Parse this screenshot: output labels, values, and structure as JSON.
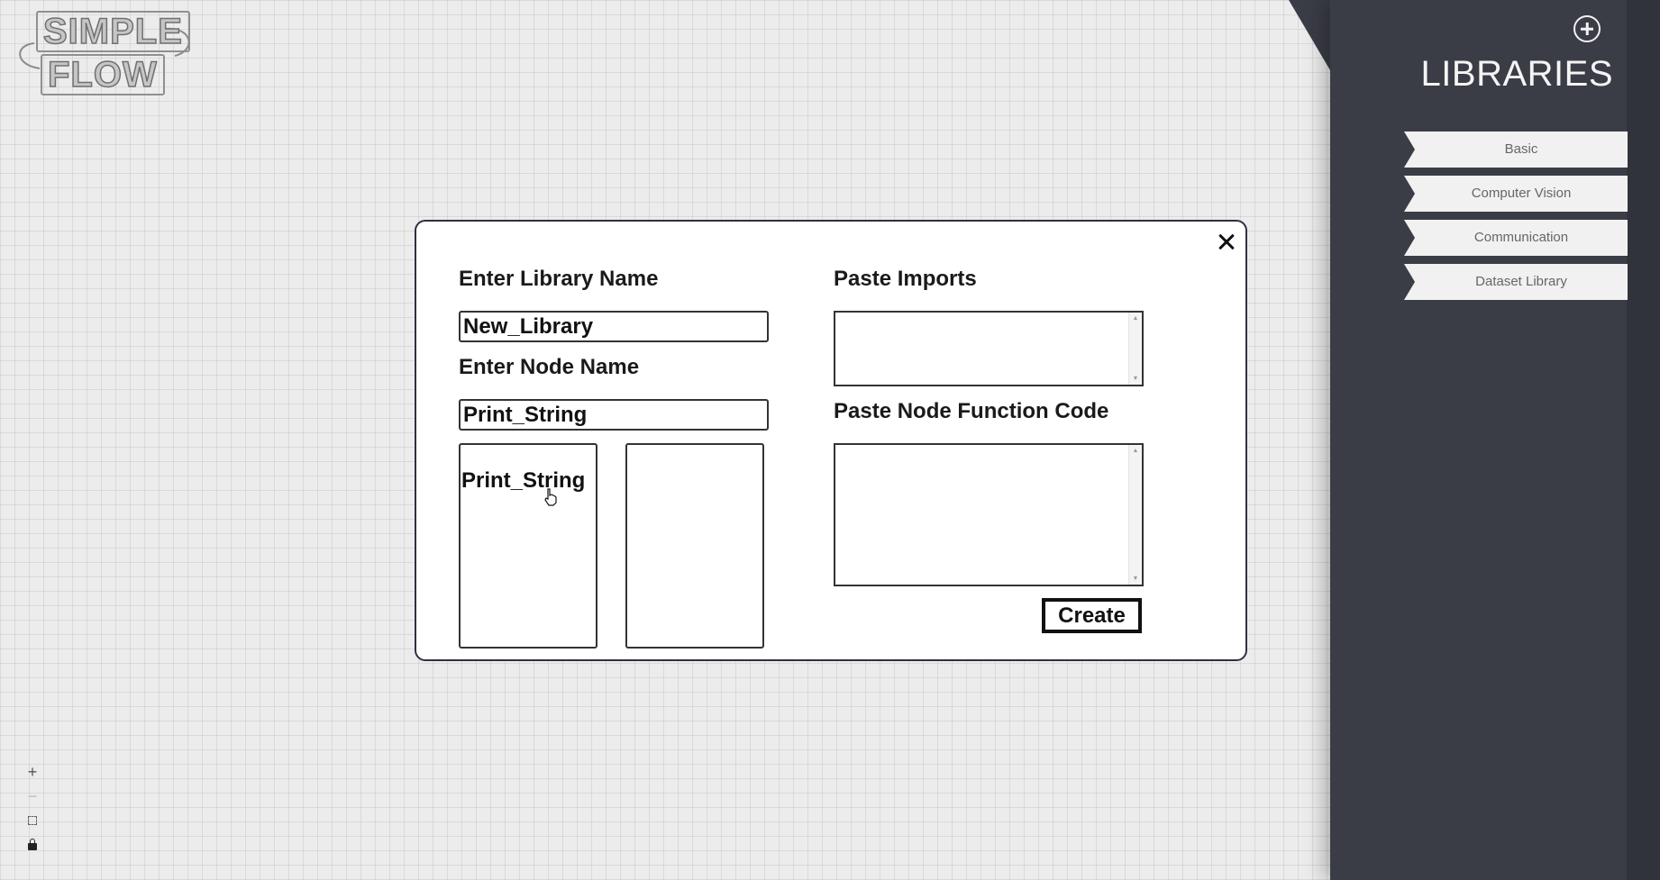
{
  "logo": {
    "line1": "SIMPLE",
    "line2": "FLOW"
  },
  "sidebar": {
    "title": "LIBRARIES",
    "add_icon": "plus-circle-icon",
    "libraries": [
      {
        "label": "Basic"
      },
      {
        "label": "Computer Vision"
      },
      {
        "label": "Communication"
      },
      {
        "label": "Dataset Library"
      }
    ]
  },
  "zoom_controls": {
    "zoom_in": "+",
    "zoom_out": "−",
    "fit_icon": "fit-view-icon",
    "lock_icon": "lock-icon"
  },
  "modal": {
    "close_icon": "close-icon",
    "library_name_label": "Enter Library Name",
    "library_name_value": "New_Library",
    "node_name_label": "Enter Node Name",
    "node_name_value": "Print_String",
    "node_preview_name": "Print_String",
    "imports_label": "Paste Imports",
    "imports_value": "",
    "code_label": "Paste Node Function Code",
    "code_value": "",
    "create_label": "Create"
  },
  "colors": {
    "sidebar_bg": "#3b3d46",
    "canvas_bg": "#ececec",
    "modal_border": "#2f3140"
  }
}
